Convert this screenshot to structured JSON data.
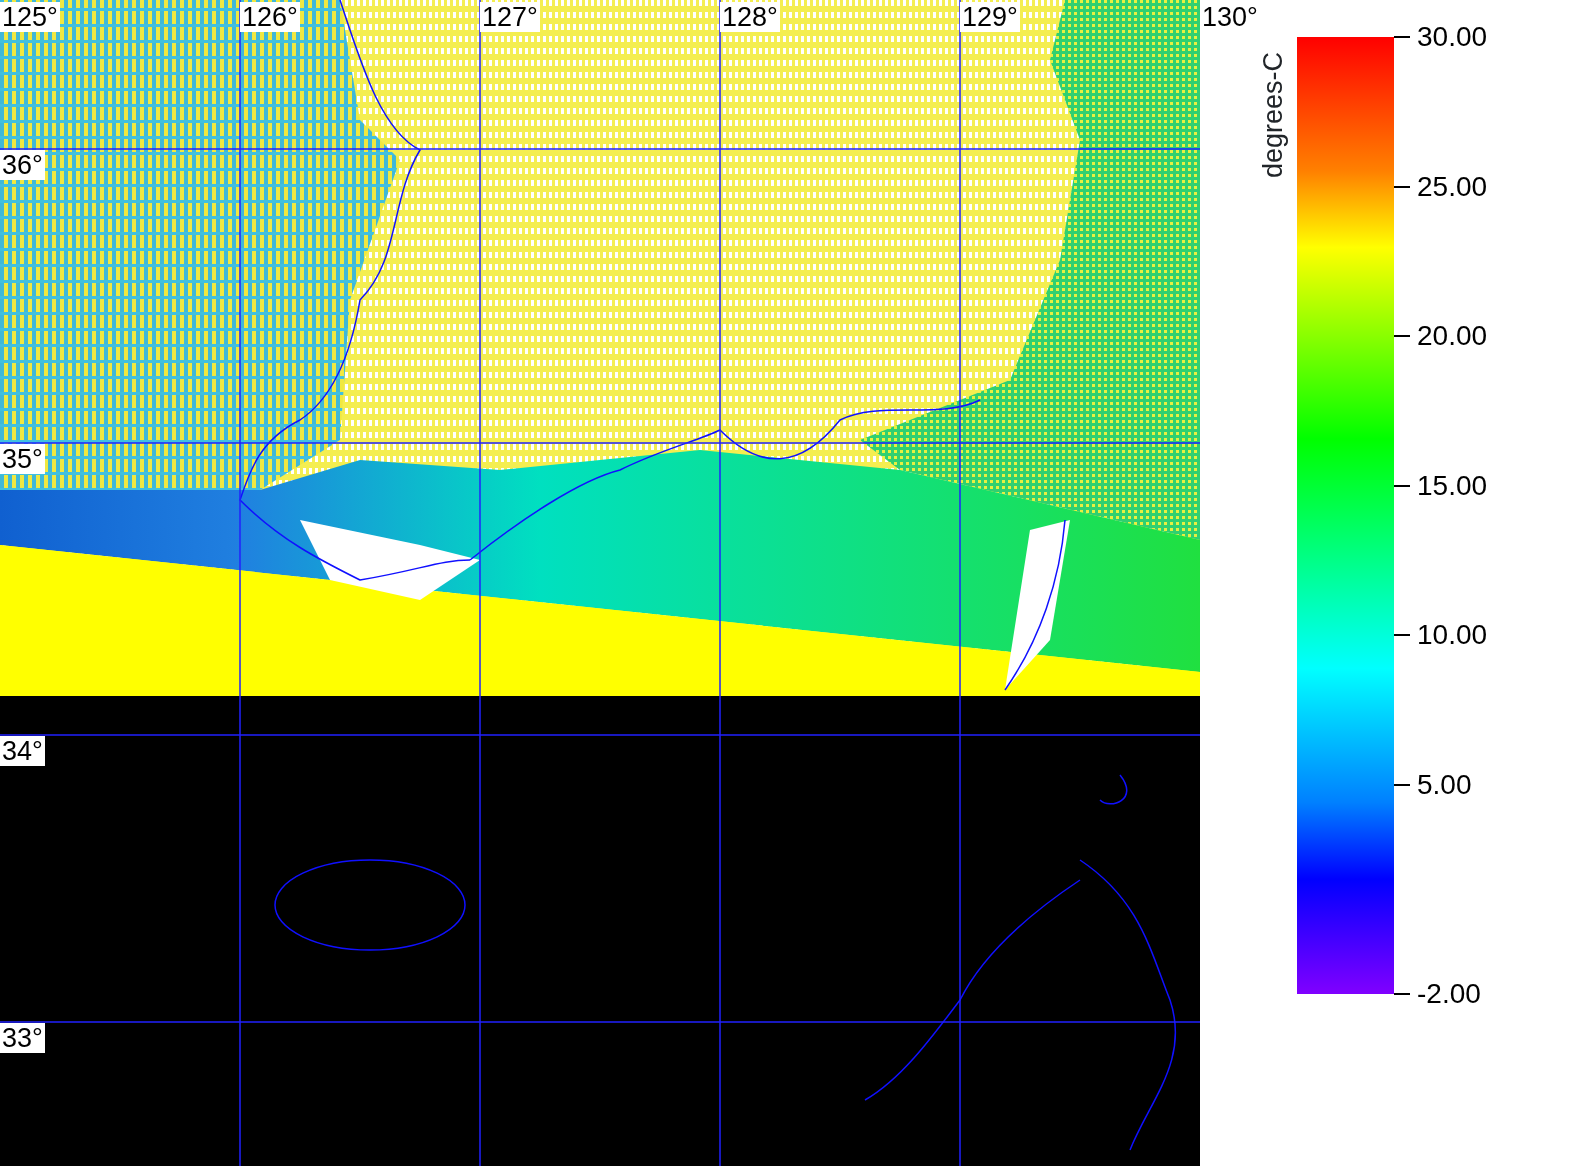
{
  "map": {
    "lon_labels": [
      "125°",
      "126°",
      "127°",
      "128°",
      "129°",
      "130°"
    ],
    "lat_labels": [
      "36°",
      "35°",
      "34°",
      "33°"
    ]
  },
  "colorbar": {
    "unit": "degrees-C",
    "ticks": [
      "30.00",
      "25.00",
      "20.00",
      "15.00",
      "10.00",
      "5.00",
      "-2.00"
    ]
  }
}
